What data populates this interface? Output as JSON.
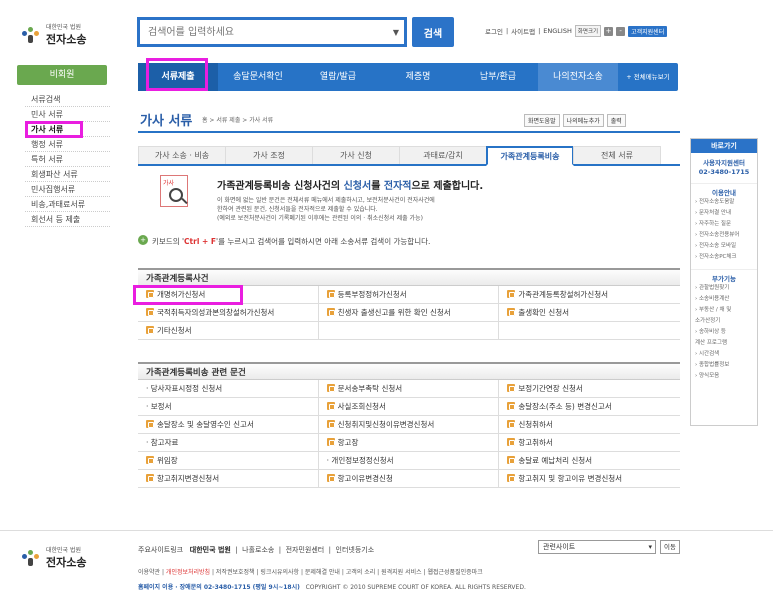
{
  "header": {
    "logo_line1": "대한민국 법원",
    "logo_line2": "전자소송",
    "search_placeholder": "검색어를 입력하세요",
    "search_button": "검색",
    "toplinks": [
      "로그인",
      "|",
      "사이트맵",
      "|",
      "ENGLISH"
    ],
    "font_size_label": "화면크기",
    "zoom_in": "+",
    "zoom_out": "-",
    "customer_center": "고객지원센터"
  },
  "left_nav": {
    "title": "비회원",
    "items": [
      "서류검색",
      "민사 서류",
      "가사 서류",
      "행정 서류",
      "특허 서류",
      "회생파산 서류",
      "민사집행서류",
      "비송,과태료서류",
      "회선서 등 제출"
    ]
  },
  "menu": [
    "서류제출",
    "송달문서확인",
    "열람/발급",
    "제증명",
    "납부/환급",
    "나의전자소송",
    "+ 전체메뉴보기"
  ],
  "page": {
    "title": "가사 서류",
    "breadcrumb": "홈 > 서류 제출 > 가사 서류",
    "tools": [
      "화면도움말",
      "나의메뉴추가",
      "출력"
    ]
  },
  "tabs": [
    "가사 소송 · 비송",
    "가사 조정",
    "가사 신청",
    "과태료/감치",
    "가족관계등록비송",
    "전체 서류"
  ],
  "info": {
    "icon_label": "가사",
    "title_pre": "가족관계등록비송 신청사건의 ",
    "title_hl1": "신청서",
    "title_mid": "를 ",
    "title_hl2": "전자적",
    "title_post": "으로 제출합니다.",
    "line1": "이 화면에 없는 일반 문건은 전체서류 메뉴에서 제출하시고, 보전처분사건이 전자사건에",
    "line2": "한하여 관련된 문건, 신청서들을 전자적으로 제출할 수 있습니다.",
    "line3": "(예외로 보전처분사건이 기록폐기된 이후에는 관련된 이의 · 취소신청서 제출 가능)",
    "kb_icon": "+",
    "kb_pre": "키보드의 '",
    "kb_key": "Ctrl + F",
    "kb_post": "'를 누르시고 검색어를 입력하시면 아래 소송서류 검색이 가능합니다."
  },
  "section1": {
    "title": "가족관계등록사건",
    "items": [
      "개명허가신청서",
      "등록부정정허가신청서",
      "가족관계등록창설허가신청서",
      "국적취득자의성과본의창설허가신청서",
      "친생자 출생신고를 위한 확인 신청서",
      "출생확인 신청서",
      "기타신청서",
      "",
      ""
    ],
    "icons": [
      true,
      true,
      true,
      true,
      true,
      true,
      true,
      false,
      false
    ]
  },
  "section2": {
    "title": "가족관계등록비송 관련 문건",
    "items": [
      "· 당사자표시정정 신청서",
      "문서송부촉탁 신청서",
      "보정기간연장 신청서",
      "· 보정서",
      "사실조회신청서",
      "송달장소(주소 등) 변경신고서",
      "송달장소 및 송달영수인 신고서",
      "신청취지및신청이유변경신청서",
      "신청취하서",
      "· 참고자료",
      "항고장",
      "항고취하서",
      "위임장",
      "· 개인정보정정신청서",
      "송달료 예납처리 신청서",
      "항고취지변경신청서",
      "항고이유변경신청",
      "항고취지 및 항고이유 변경신청서"
    ],
    "icons": [
      false,
      true,
      true,
      false,
      true,
      true,
      true,
      true,
      true,
      false,
      true,
      true,
      true,
      false,
      true,
      true,
      true,
      true
    ]
  },
  "quick": {
    "title": "바로가기",
    "center_name": "사용자지원센터",
    "center_phone": "02-3480-1715",
    "guide_title": "이용안내",
    "guide_items": [
      "› 전자소송도움말",
      "› 문자처결 안내",
      "› 자주하는 질문",
      "› 전자소송전용뷰어",
      "› 전자소송 모바일",
      "› 전자소송PC체크"
    ],
    "func_title": "부가기능",
    "func_items": [
      "› 관할법원찾기",
      "› 소송비용계산",
      "› 부동산 / 채 및",
      "  소가산정기",
      "› 송하비상 등",
      "  계산 프로그램",
      "› 시간검색",
      "› 종합법률정보",
      "› 양식모음"
    ]
  },
  "footer": {
    "logo_line1": "대한민국 법원",
    "logo_line2": "전자소송",
    "links_label": "주요사이트링크",
    "links": [
      "대한민국 법원",
      "나홀로소송",
      "전자민원센터",
      "인터넷등기소"
    ],
    "select_value": "관련사이트",
    "go_button": "이동",
    "line2_pre": "이용약관 | ",
    "line2_red": "개인정보처리방침",
    "line2_post": " | 저작권보호정책 | 링크시유의사항 | 문제해결 안내 | 고객의 소리 | 원격지원 서비스 | 웹접근성품질인증마크",
    "line3_phone": "홈페이지 이용 · 장애문의 02-3480-1715 (평일 9시~18시)",
    "line3_copy": "COPYRIGHT © 2010 SUPREME COURT OF KOREA. ALL RIGHTS RESERVED."
  },
  "colors": {
    "primary": "#2773c6",
    "nav_green": "#6aa84f",
    "highlight": "#e91ee0",
    "doc_icon": "#e8a13a"
  }
}
